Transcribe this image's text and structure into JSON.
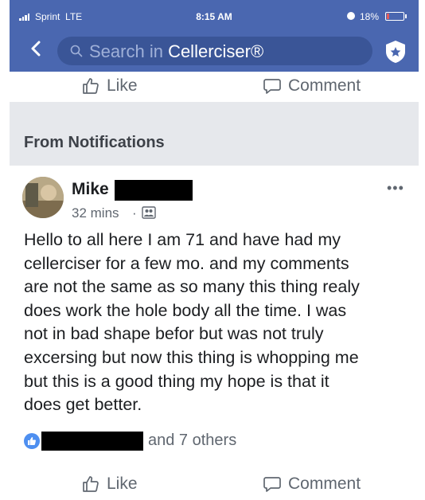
{
  "status_bar": {
    "carrier": "Sprint",
    "network": "LTE",
    "time": "8:15 AM",
    "battery": "18%",
    "battery_level": 0.18
  },
  "nav": {
    "search_prefix": "Search in ",
    "search_target": "Cellerciser®",
    "icons": [
      "back-chevron-icon",
      "search-icon",
      "shield-star-icon"
    ]
  },
  "actions": {
    "like": "Like",
    "comment": "Comment"
  },
  "section": {
    "title": "From Notifications"
  },
  "post": {
    "author": "Mike",
    "timestamp": "32 mins",
    "separator": "·",
    "body_lines": [
      "Hello to all here I am 71 and have had my",
      "cellerciser for a few mo. and my comments",
      "are not the same as so many this thing realy",
      "does work the hole body all the time. I was",
      "not in bad shape befor but was not truly",
      "excersing but now this thing is whopping me",
      "but this is a good thing my hope is that it",
      "does get better."
    ],
    "reactions": "and 7 others",
    "more": "•••"
  },
  "colors": {
    "nav_bg": "#4a67b0",
    "search_bg": "#3a5597",
    "text": "#1c1e21",
    "secondary_text": "#606770",
    "section_bg": "#e6e8ec",
    "like_blue": "#4e8ff0"
  }
}
